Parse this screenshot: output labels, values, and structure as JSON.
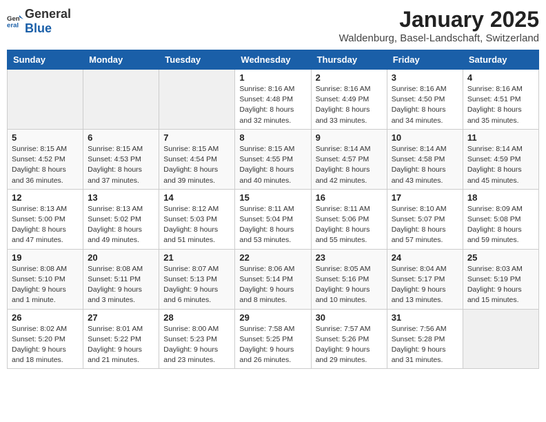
{
  "header": {
    "logo_general": "General",
    "logo_blue": "Blue",
    "title": "January 2025",
    "subtitle": "Waldenburg, Basel-Landschaft, Switzerland"
  },
  "days_of_week": [
    "Sunday",
    "Monday",
    "Tuesday",
    "Wednesday",
    "Thursday",
    "Friday",
    "Saturday"
  ],
  "weeks": [
    [
      {
        "day": "",
        "info": ""
      },
      {
        "day": "",
        "info": ""
      },
      {
        "day": "",
        "info": ""
      },
      {
        "day": "1",
        "info": "Sunrise: 8:16 AM\nSunset: 4:48 PM\nDaylight: 8 hours\nand 32 minutes."
      },
      {
        "day": "2",
        "info": "Sunrise: 8:16 AM\nSunset: 4:49 PM\nDaylight: 8 hours\nand 33 minutes."
      },
      {
        "day": "3",
        "info": "Sunrise: 8:16 AM\nSunset: 4:50 PM\nDaylight: 8 hours\nand 34 minutes."
      },
      {
        "day": "4",
        "info": "Sunrise: 8:16 AM\nSunset: 4:51 PM\nDaylight: 8 hours\nand 35 minutes."
      }
    ],
    [
      {
        "day": "5",
        "info": "Sunrise: 8:15 AM\nSunset: 4:52 PM\nDaylight: 8 hours\nand 36 minutes."
      },
      {
        "day": "6",
        "info": "Sunrise: 8:15 AM\nSunset: 4:53 PM\nDaylight: 8 hours\nand 37 minutes."
      },
      {
        "day": "7",
        "info": "Sunrise: 8:15 AM\nSunset: 4:54 PM\nDaylight: 8 hours\nand 39 minutes."
      },
      {
        "day": "8",
        "info": "Sunrise: 8:15 AM\nSunset: 4:55 PM\nDaylight: 8 hours\nand 40 minutes."
      },
      {
        "day": "9",
        "info": "Sunrise: 8:14 AM\nSunset: 4:57 PM\nDaylight: 8 hours\nand 42 minutes."
      },
      {
        "day": "10",
        "info": "Sunrise: 8:14 AM\nSunset: 4:58 PM\nDaylight: 8 hours\nand 43 minutes."
      },
      {
        "day": "11",
        "info": "Sunrise: 8:14 AM\nSunset: 4:59 PM\nDaylight: 8 hours\nand 45 minutes."
      }
    ],
    [
      {
        "day": "12",
        "info": "Sunrise: 8:13 AM\nSunset: 5:00 PM\nDaylight: 8 hours\nand 47 minutes."
      },
      {
        "day": "13",
        "info": "Sunrise: 8:13 AM\nSunset: 5:02 PM\nDaylight: 8 hours\nand 49 minutes."
      },
      {
        "day": "14",
        "info": "Sunrise: 8:12 AM\nSunset: 5:03 PM\nDaylight: 8 hours\nand 51 minutes."
      },
      {
        "day": "15",
        "info": "Sunrise: 8:11 AM\nSunset: 5:04 PM\nDaylight: 8 hours\nand 53 minutes."
      },
      {
        "day": "16",
        "info": "Sunrise: 8:11 AM\nSunset: 5:06 PM\nDaylight: 8 hours\nand 55 minutes."
      },
      {
        "day": "17",
        "info": "Sunrise: 8:10 AM\nSunset: 5:07 PM\nDaylight: 8 hours\nand 57 minutes."
      },
      {
        "day": "18",
        "info": "Sunrise: 8:09 AM\nSunset: 5:08 PM\nDaylight: 8 hours\nand 59 minutes."
      }
    ],
    [
      {
        "day": "19",
        "info": "Sunrise: 8:08 AM\nSunset: 5:10 PM\nDaylight: 9 hours\nand 1 minute."
      },
      {
        "day": "20",
        "info": "Sunrise: 8:08 AM\nSunset: 5:11 PM\nDaylight: 9 hours\nand 3 minutes."
      },
      {
        "day": "21",
        "info": "Sunrise: 8:07 AM\nSunset: 5:13 PM\nDaylight: 9 hours\nand 6 minutes."
      },
      {
        "day": "22",
        "info": "Sunrise: 8:06 AM\nSunset: 5:14 PM\nDaylight: 9 hours\nand 8 minutes."
      },
      {
        "day": "23",
        "info": "Sunrise: 8:05 AM\nSunset: 5:16 PM\nDaylight: 9 hours\nand 10 minutes."
      },
      {
        "day": "24",
        "info": "Sunrise: 8:04 AM\nSunset: 5:17 PM\nDaylight: 9 hours\nand 13 minutes."
      },
      {
        "day": "25",
        "info": "Sunrise: 8:03 AM\nSunset: 5:19 PM\nDaylight: 9 hours\nand 15 minutes."
      }
    ],
    [
      {
        "day": "26",
        "info": "Sunrise: 8:02 AM\nSunset: 5:20 PM\nDaylight: 9 hours\nand 18 minutes."
      },
      {
        "day": "27",
        "info": "Sunrise: 8:01 AM\nSunset: 5:22 PM\nDaylight: 9 hours\nand 21 minutes."
      },
      {
        "day": "28",
        "info": "Sunrise: 8:00 AM\nSunset: 5:23 PM\nDaylight: 9 hours\nand 23 minutes."
      },
      {
        "day": "29",
        "info": "Sunrise: 7:58 AM\nSunset: 5:25 PM\nDaylight: 9 hours\nand 26 minutes."
      },
      {
        "day": "30",
        "info": "Sunrise: 7:57 AM\nSunset: 5:26 PM\nDaylight: 9 hours\nand 29 minutes."
      },
      {
        "day": "31",
        "info": "Sunrise: 7:56 AM\nSunset: 5:28 PM\nDaylight: 9 hours\nand 31 minutes."
      },
      {
        "day": "",
        "info": ""
      }
    ]
  ]
}
